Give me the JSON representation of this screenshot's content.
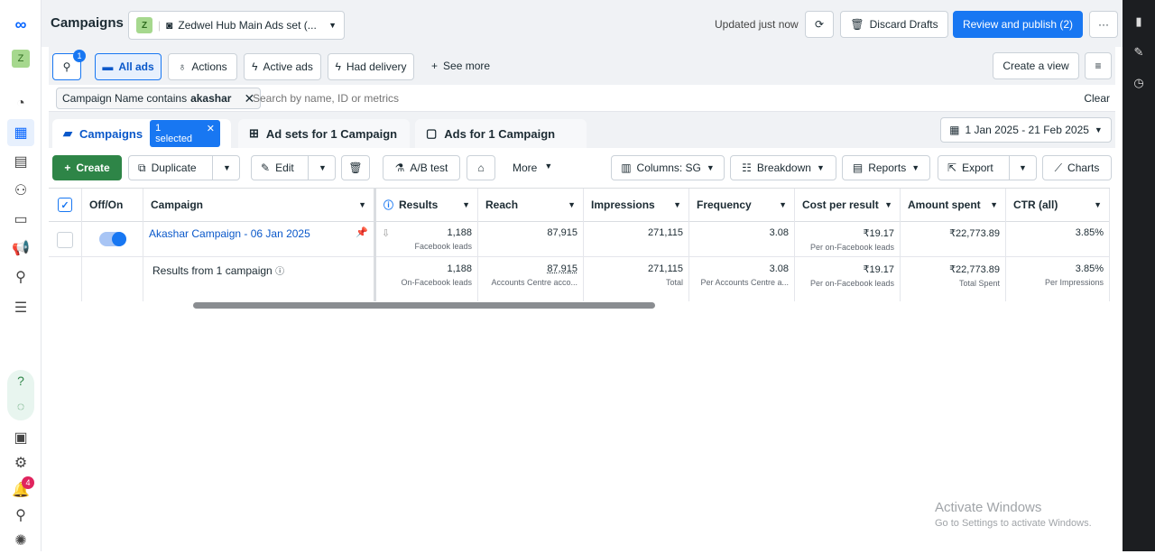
{
  "header": {
    "title": "Campaigns",
    "account_initial": "Z",
    "account_name": "Zedwel Hub Main Ads set (...",
    "updated": "Updated just now",
    "discard": "Discard Drafts",
    "review": "Review and publish (2)",
    "more": "···"
  },
  "filters": {
    "search_badge": "1",
    "all_ads": "All ads",
    "actions": "Actions",
    "active_ads": "Active ads",
    "had_delivery": "Had delivery",
    "see_more": "See more",
    "create_view": "Create a view"
  },
  "search": {
    "chip_prefix": "Campaign Name contains ",
    "chip_value": "akashar",
    "placeholder": "Search by name, ID or metrics",
    "clear": "Clear"
  },
  "tabs": {
    "campaigns": "Campaigns",
    "selected": "1 selected",
    "adsets": "Ad sets for 1 Campaign",
    "ads": "Ads for 1 Campaign",
    "date_range": "1 Jan 2025 - 21 Feb 2025"
  },
  "toolbar": {
    "create": "Create",
    "duplicate": "Duplicate",
    "edit": "Edit",
    "ab_test": "A/B test",
    "more": "More",
    "columns": "Columns: SG",
    "breakdown": "Breakdown",
    "reports": "Reports",
    "export": "Export",
    "charts": "Charts"
  },
  "table": {
    "headers": {
      "offon": "Off/On",
      "campaign": "Campaign",
      "results": "Results",
      "reach": "Reach",
      "impressions": "Impressions",
      "frequency": "Frequency",
      "cost": "Cost per result",
      "amount": "Amount spent",
      "ctr": "CTR (all)"
    },
    "row": {
      "name": "Akashar Campaign - 06 Jan 2025",
      "results": "1,188",
      "results_sub": "Facebook leads",
      "reach": "87,915",
      "impressions": "271,115",
      "frequency": "3.08",
      "cost": "₹19.17",
      "cost_sub": "Per on-Facebook leads",
      "amount": "₹22,773.89",
      "ctr": "3.85%"
    },
    "summary": {
      "label": "Results from 1 campaign",
      "results": "1,188",
      "results_sub": "On-Facebook leads",
      "reach": "87,915",
      "reach_sub": "Accounts Centre acco...",
      "impressions": "271,115",
      "impressions_sub": "Total",
      "frequency": "3.08",
      "frequency_sub": "Per Accounts Centre a...",
      "cost": "₹19.17",
      "cost_sub": "Per on-Facebook leads",
      "amount": "₹22,773.89",
      "amount_sub": "Total Spent",
      "ctr": "3.85%",
      "ctr_sub": "Per Impressions"
    }
  },
  "nav": {
    "notification_count": "4"
  },
  "watermark": {
    "title": "Activate Windows",
    "subtitle": "Go to Settings to activate Windows."
  }
}
